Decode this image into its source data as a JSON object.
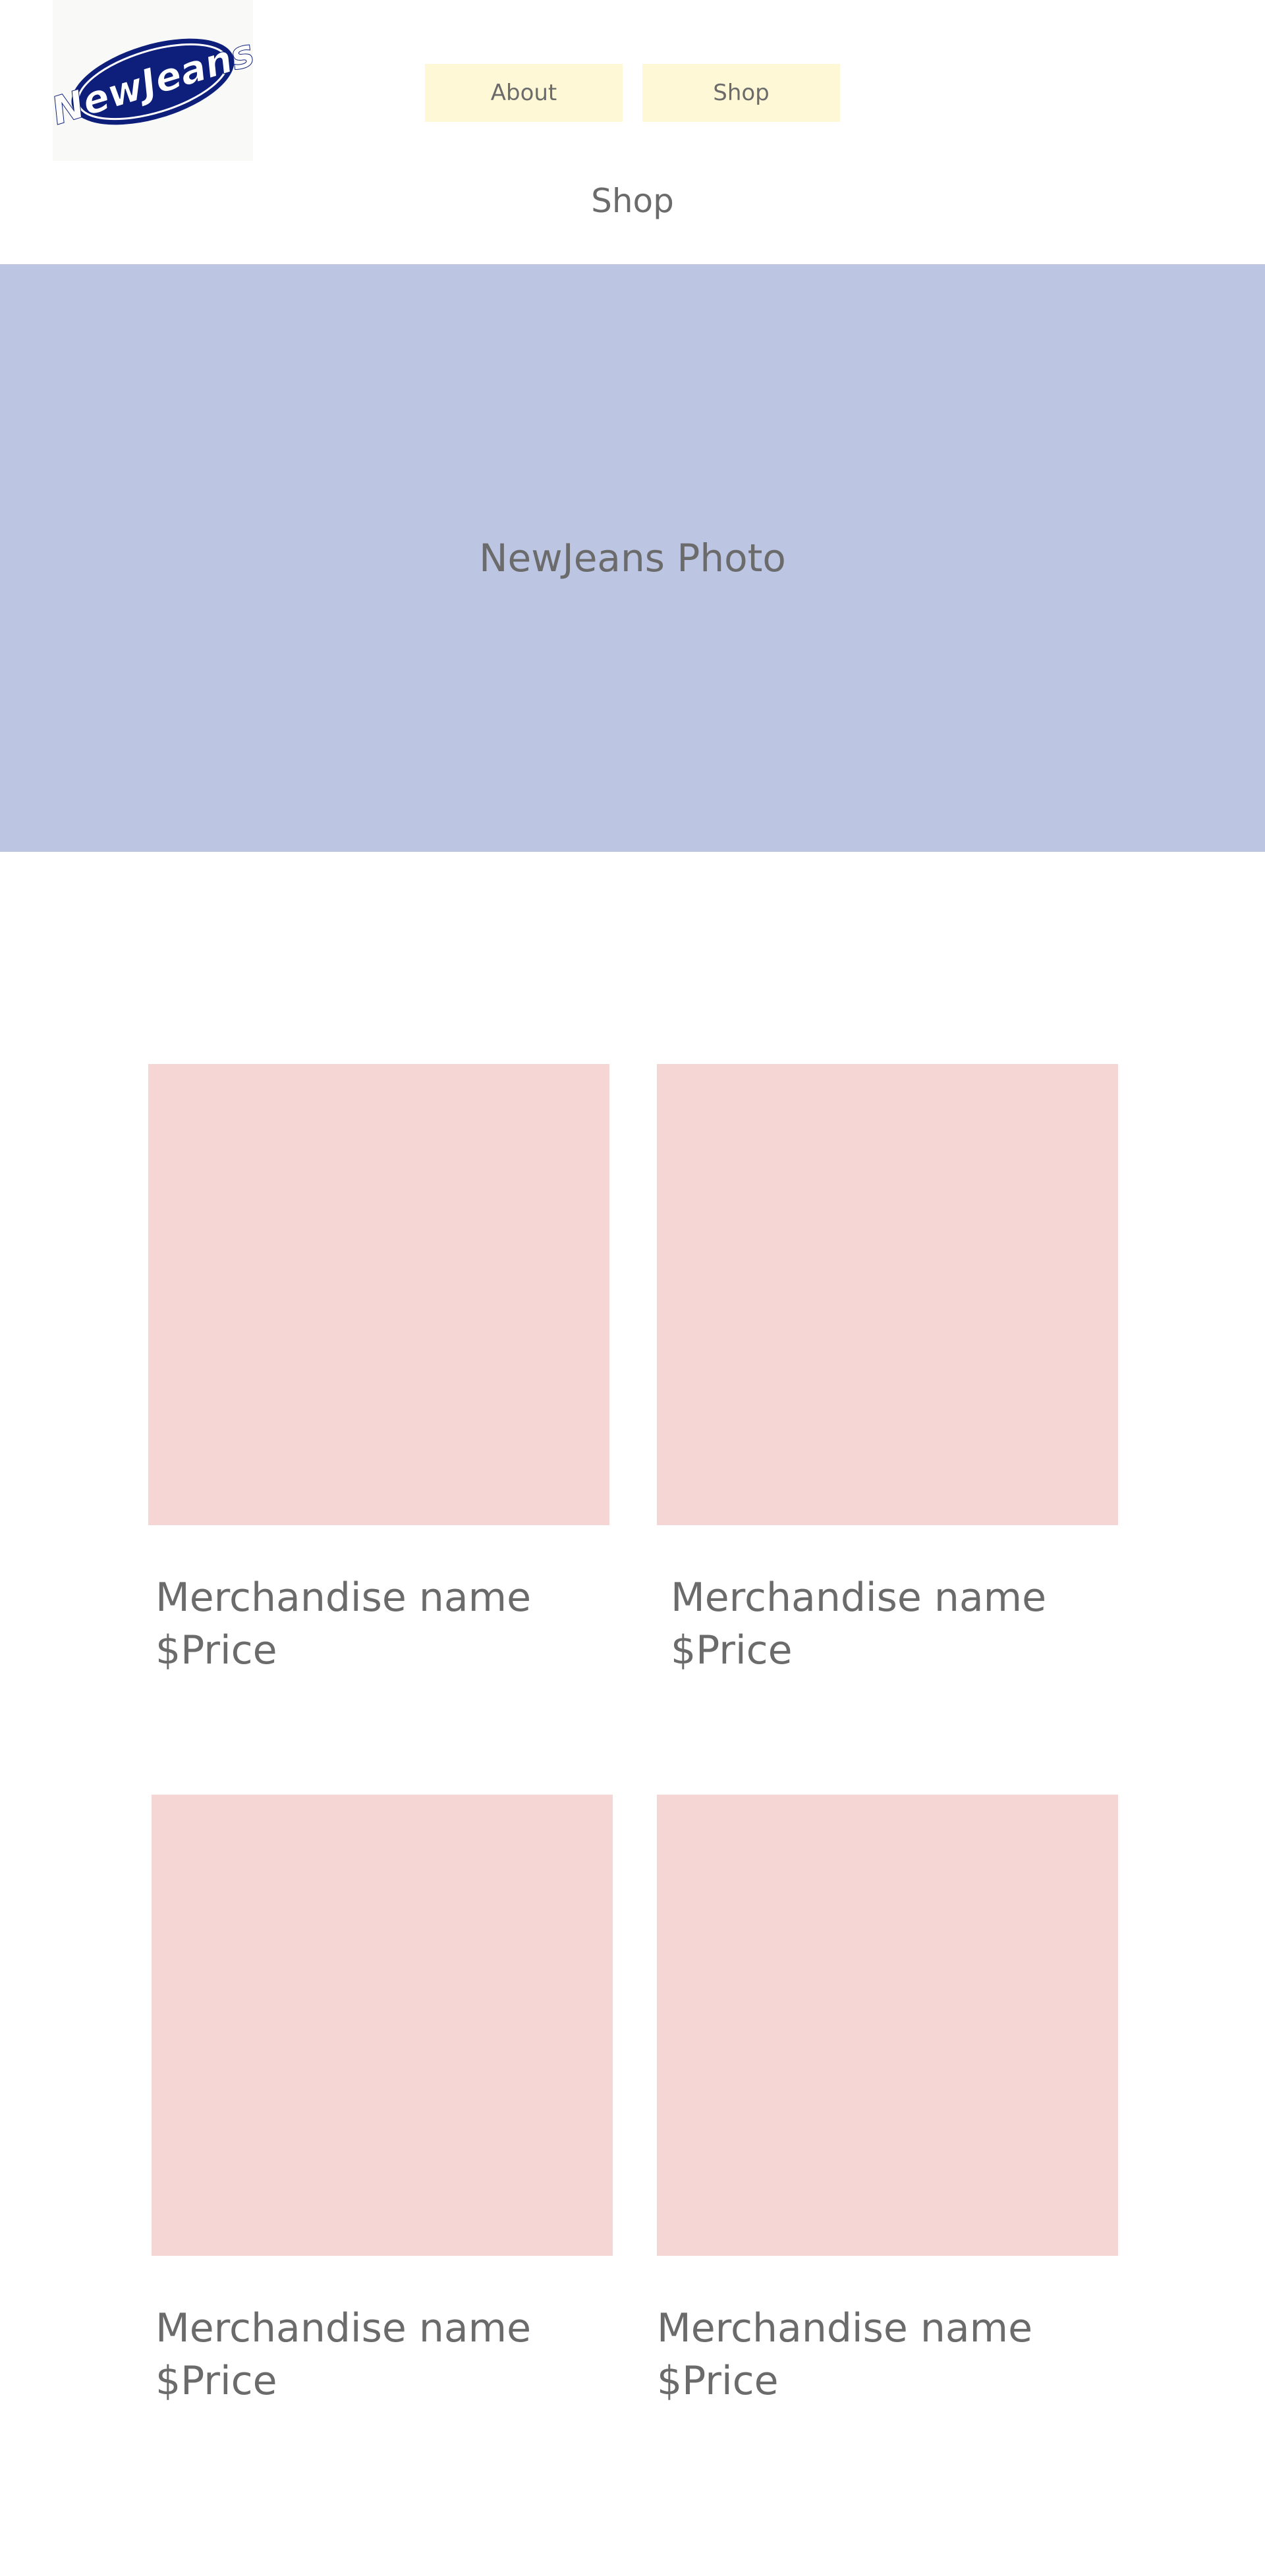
{
  "header": {
    "logo_text": "NewJeans",
    "nav": [
      {
        "label": "About"
      },
      {
        "label": "Shop"
      }
    ]
  },
  "page": {
    "title": "Shop"
  },
  "hero": {
    "label": "NewJeans Photo"
  },
  "products": [
    {
      "name": "Merchandise name",
      "price": "$Price"
    },
    {
      "name": "Merchandise name",
      "price": "$Price"
    },
    {
      "name": "Merchandise name",
      "price": "$Price"
    },
    {
      "name": "Merchandise name",
      "price": "$Price"
    }
  ],
  "colors": {
    "nav_button": "#fff8d6",
    "hero_background": "#bcc6e3",
    "product_placeholder": "#f6d6d5",
    "logo_blue": "#0d1f7a",
    "text": "#6b6b6b"
  }
}
